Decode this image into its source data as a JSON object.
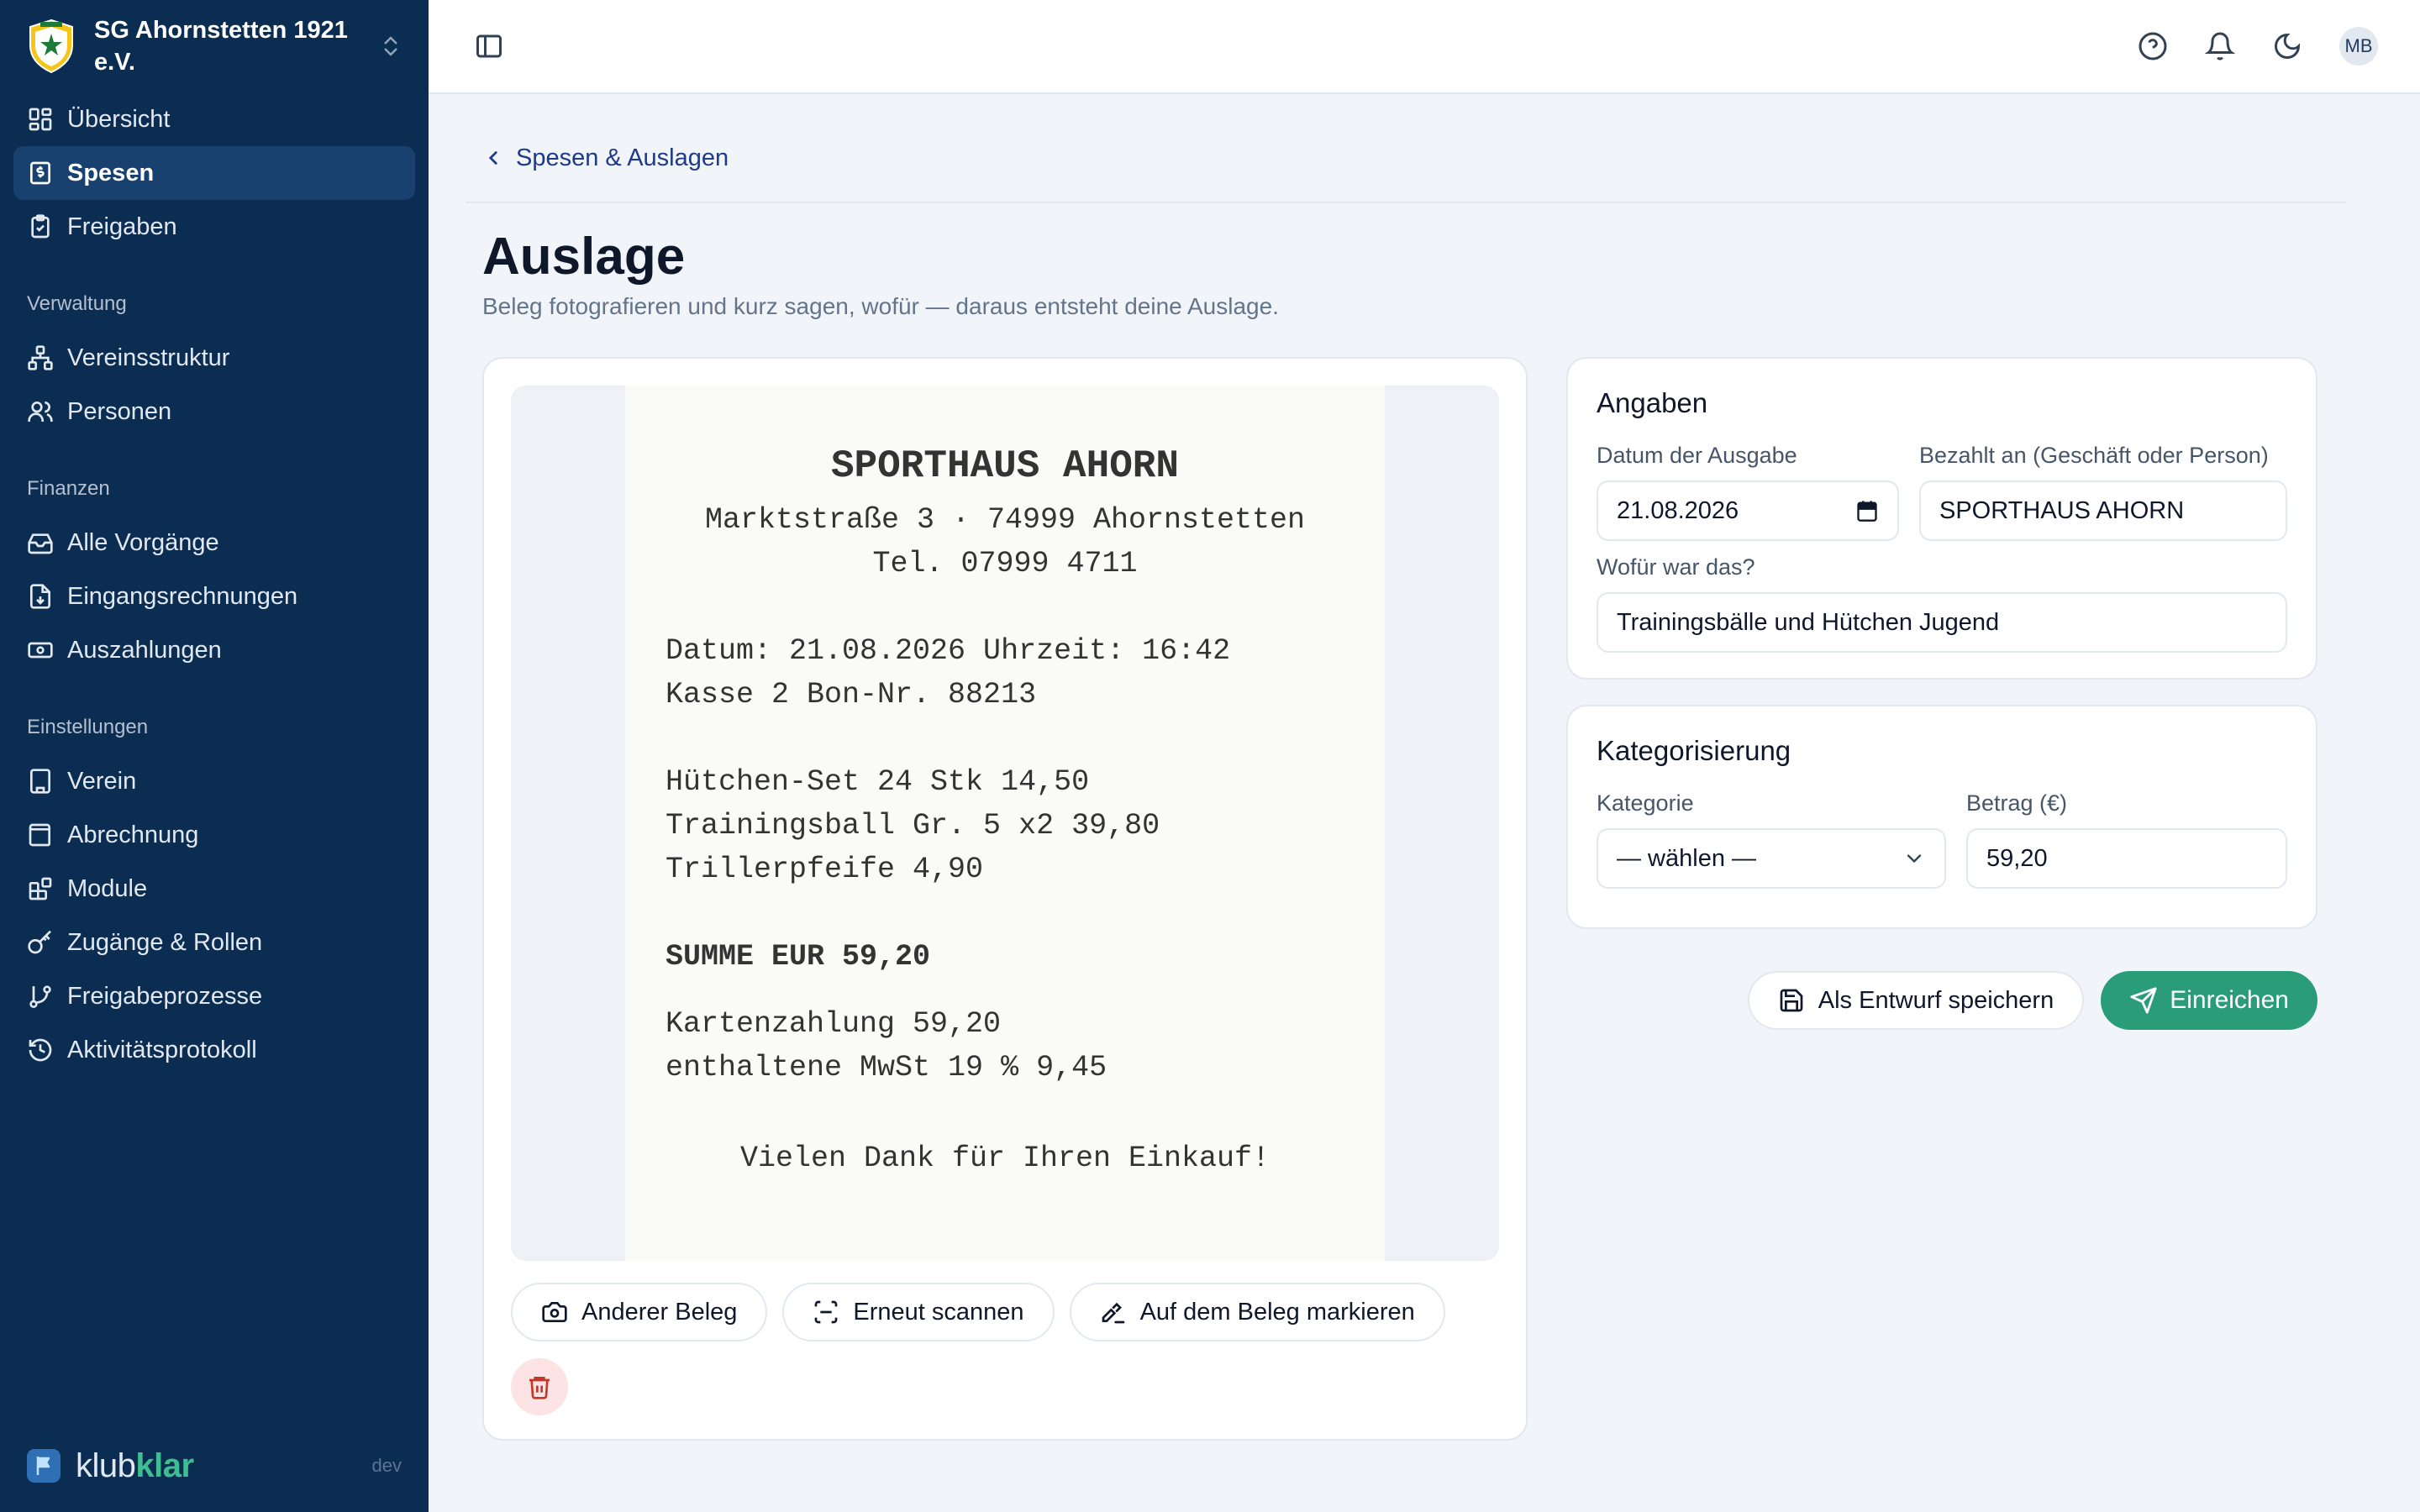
{
  "org": {
    "name": "SG Ahornstetten 1921 e.V."
  },
  "nav": {
    "main": [
      {
        "label": "Übersicht"
      },
      {
        "label": "Spesen"
      },
      {
        "label": "Freigaben"
      }
    ],
    "sections": [
      {
        "title": "Verwaltung",
        "items": [
          {
            "label": "Vereinsstruktur"
          },
          {
            "label": "Personen"
          }
        ]
      },
      {
        "title": "Finanzen",
        "items": [
          {
            "label": "Alle Vorgänge"
          },
          {
            "label": "Eingangsrechnungen"
          },
          {
            "label": "Auszahlungen"
          }
        ]
      },
      {
        "title": "Einstellungen",
        "items": [
          {
            "label": "Verein"
          },
          {
            "label": "Abrechnung"
          },
          {
            "label": "Module"
          },
          {
            "label": "Zugänge & Rollen"
          },
          {
            "label": "Freigabeprozesse"
          },
          {
            "label": "Aktivitätsprotokoll"
          }
        ]
      }
    ]
  },
  "brand": {
    "part1": "klub",
    "part2": "klar",
    "env": "dev"
  },
  "topbar": {
    "avatar": "MB"
  },
  "breadcrumb": {
    "label": "Spesen & Auslagen"
  },
  "page": {
    "title": "Auslage",
    "subtitle": "Beleg fotografieren und kurz sagen, wofür — daraus entsteht deine Auslage."
  },
  "receipt": {
    "shop": "SPORTHAUS AHORN",
    "address": "Marktstraße 3 · 74999 Ahornstetten",
    "phone": "Tel. 07999 4711",
    "date_line": "Datum: 21.08.2026 Uhrzeit: 16:42",
    "register_line": "Kasse 2 Bon-Nr. 88213",
    "items": [
      "Hütchen-Set 24 Stk 14,50",
      "Trainingsball Gr. 5 x2 39,80",
      "Trillerpfeife 4,90"
    ],
    "total": "SUMME EUR 59,20",
    "payment": "Kartenzahlung 59,20",
    "tax": "enthaltene MwSt 19 % 9,45",
    "thanks": "Vielen Dank für Ihren Einkauf!"
  },
  "receipt_actions": {
    "other": "Anderer Beleg",
    "rescan": "Erneut scannen",
    "mark": "Auf dem Beleg markieren"
  },
  "details": {
    "title": "Angaben",
    "date_label": "Datum der Ausgabe",
    "date_value": "21.08.2026",
    "payee_label": "Bezahlt an (Geschäft oder Person)",
    "payee_value": "SPORTHAUS AHORN",
    "purpose_label": "Wofür war das?",
    "purpose_value": "Trainingsbälle und Hütchen Jugend"
  },
  "categorization": {
    "title": "Kategorisierung",
    "category_label": "Kategorie",
    "category_value": "— wählen —",
    "amount_label": "Betrag (€)",
    "amount_value": "59,20"
  },
  "actions": {
    "save_draft": "Als Entwurf speichern",
    "submit": "Einreichen"
  },
  "colors": {
    "sidebar": "#0c2d52",
    "active": "#184170",
    "primary": "#2a9d78",
    "brand_accent": "#3fbf91"
  }
}
